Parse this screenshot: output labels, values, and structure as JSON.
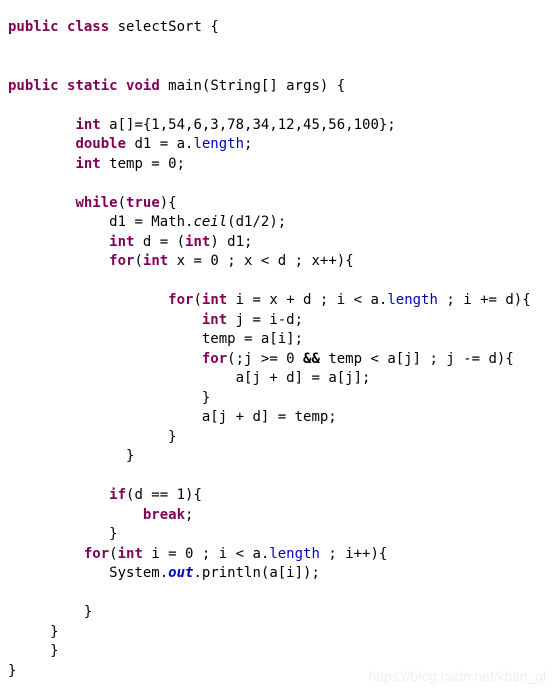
{
  "editor": {
    "language": "java",
    "class_name": "selectSort",
    "background_color": "#ffffff",
    "keyword_color": "#7f0055",
    "field_color": "#0000c0",
    "plain_color": "#000000",
    "watermark_color": "#efefef"
  },
  "watermark": {
    "text": "https://blog.csdn.net/kbsn_gl"
  },
  "code": {
    "lines": [
      {
        "id": "l1",
        "indent": 0,
        "tokens": [
          {
            "t": "public",
            "c": "kw"
          },
          {
            "t": " ",
            "c": "plain"
          },
          {
            "t": "class",
            "c": "kw"
          },
          {
            "t": " selectSort {",
            "c": "plain"
          }
        ]
      },
      {
        "id": "l2",
        "indent": 0,
        "tokens": []
      },
      {
        "id": "l3",
        "indent": 0,
        "tokens": []
      },
      {
        "id": "l4",
        "indent": 0,
        "tokens": [
          {
            "t": "public",
            "c": "kw"
          },
          {
            "t": " ",
            "c": "plain"
          },
          {
            "t": "static",
            "c": "kw"
          },
          {
            "t": " ",
            "c": "plain"
          },
          {
            "t": "void",
            "c": "kw"
          },
          {
            "t": " main(String[] args) {",
            "c": "plain"
          }
        ]
      },
      {
        "id": "l5",
        "indent": 0,
        "tokens": []
      },
      {
        "id": "l6",
        "indent": 8,
        "tokens": [
          {
            "t": "int",
            "c": "kw"
          },
          {
            "t": " a[]={1,54,6,3,78,34,12,45,56,100};",
            "c": "plain"
          }
        ]
      },
      {
        "id": "l7",
        "indent": 8,
        "tokens": [
          {
            "t": "double",
            "c": "kw"
          },
          {
            "t": " d1 = a.",
            "c": "plain"
          },
          {
            "t": "length",
            "c": "field"
          },
          {
            "t": ";",
            "c": "plain"
          }
        ]
      },
      {
        "id": "l8",
        "indent": 8,
        "tokens": [
          {
            "t": "int",
            "c": "kw"
          },
          {
            "t": " temp = 0;",
            "c": "plain"
          }
        ]
      },
      {
        "id": "l9",
        "indent": 0,
        "tokens": []
      },
      {
        "id": "l10",
        "indent": 8,
        "tokens": [
          {
            "t": "while",
            "c": "kw"
          },
          {
            "t": "(",
            "c": "plain"
          },
          {
            "t": "true",
            "c": "kw"
          },
          {
            "t": "){",
            "c": "plain"
          }
        ]
      },
      {
        "id": "l11",
        "indent": 12,
        "tokens": [
          {
            "t": "d1 = Math.",
            "c": "plain"
          },
          {
            "t": "ceil",
            "c": "statici"
          },
          {
            "t": "(d1/2);",
            "c": "plain"
          }
        ]
      },
      {
        "id": "l12",
        "indent": 12,
        "tokens": [
          {
            "t": "int",
            "c": "kw"
          },
          {
            "t": " d = (",
            "c": "plain"
          },
          {
            "t": "int",
            "c": "kw"
          },
          {
            "t": ") d1;",
            "c": "plain"
          }
        ]
      },
      {
        "id": "l13",
        "indent": 12,
        "tokens": [
          {
            "t": "for",
            "c": "kw"
          },
          {
            "t": "(",
            "c": "plain"
          },
          {
            "t": "int",
            "c": "kw"
          },
          {
            "t": " x = 0 ; x < d ; x++){",
            "c": "plain"
          }
        ]
      },
      {
        "id": "l14",
        "indent": 0,
        "tokens": []
      },
      {
        "id": "l15",
        "indent": 19,
        "tokens": [
          {
            "t": "for",
            "c": "kw"
          },
          {
            "t": "(",
            "c": "plain"
          },
          {
            "t": "int",
            "c": "kw"
          },
          {
            "t": " i = x + d ; i < a.",
            "c": "plain"
          },
          {
            "t": "length",
            "c": "field"
          },
          {
            "t": " ; i += d){",
            "c": "plain"
          }
        ]
      },
      {
        "id": "l16",
        "indent": 23,
        "tokens": [
          {
            "t": "int",
            "c": "kw"
          },
          {
            "t": " j = i-d;",
            "c": "plain"
          }
        ]
      },
      {
        "id": "l17",
        "indent": 23,
        "tokens": [
          {
            "t": "temp = a[i];",
            "c": "plain"
          }
        ]
      },
      {
        "id": "l18",
        "indent": 23,
        "tokens": [
          {
            "t": "for",
            "c": "kw"
          },
          {
            "t": "(;j >= 0 ",
            "c": "plain"
          },
          {
            "t": "&&",
            "c": "opb"
          },
          {
            "t": " temp < a[j] ; j -= d){",
            "c": "plain"
          }
        ]
      },
      {
        "id": "l19",
        "indent": 27,
        "tokens": [
          {
            "t": "a[j + d] = a[j];",
            "c": "plain"
          }
        ]
      },
      {
        "id": "l20",
        "indent": 23,
        "tokens": [
          {
            "t": "}",
            "c": "plain"
          }
        ]
      },
      {
        "id": "l21",
        "indent": 23,
        "tokens": [
          {
            "t": "a[j + d] = temp;",
            "c": "plain"
          }
        ]
      },
      {
        "id": "l22",
        "indent": 19,
        "tokens": [
          {
            "t": "}",
            "c": "plain"
          }
        ]
      },
      {
        "id": "l23",
        "indent": 14,
        "tokens": [
          {
            "t": "}",
            "c": "plain"
          }
        ]
      },
      {
        "id": "l24",
        "indent": 0,
        "tokens": []
      },
      {
        "id": "l25",
        "indent": 12,
        "tokens": [
          {
            "t": "if",
            "c": "kw"
          },
          {
            "t": "(d == 1){",
            "c": "plain"
          }
        ]
      },
      {
        "id": "l26",
        "indent": 16,
        "tokens": [
          {
            "t": "break",
            "c": "kw"
          },
          {
            "t": ";",
            "c": "plain"
          }
        ]
      },
      {
        "id": "l27",
        "indent": 12,
        "tokens": [
          {
            "t": "}",
            "c": "plain"
          }
        ]
      },
      {
        "id": "l28",
        "indent": 9,
        "tokens": [
          {
            "t": "for",
            "c": "kw"
          },
          {
            "t": "(",
            "c": "plain"
          },
          {
            "t": "int",
            "c": "kw"
          },
          {
            "t": " i = 0 ; i < a.",
            "c": "plain"
          },
          {
            "t": "length",
            "c": "field"
          },
          {
            "t": " ; i++){",
            "c": "plain"
          }
        ]
      },
      {
        "id": "l29",
        "indent": 12,
        "tokens": [
          {
            "t": "System.",
            "c": "plain"
          },
          {
            "t": "out",
            "c": "static"
          },
          {
            "t": ".println(a[i]);",
            "c": "plain"
          }
        ]
      },
      {
        "id": "l30",
        "indent": 0,
        "tokens": []
      },
      {
        "id": "l31",
        "indent": 9,
        "tokens": [
          {
            "t": "}",
            "c": "plain"
          }
        ]
      },
      {
        "id": "l32",
        "indent": 5,
        "tokens": [
          {
            "t": "}",
            "c": "plain"
          }
        ]
      },
      {
        "id": "l33",
        "indent": 5,
        "tokens": [
          {
            "t": "}",
            "c": "plain"
          }
        ]
      },
      {
        "id": "l34",
        "indent": 0,
        "tokens": [
          {
            "t": "}",
            "c": "plain"
          }
        ]
      }
    ]
  }
}
